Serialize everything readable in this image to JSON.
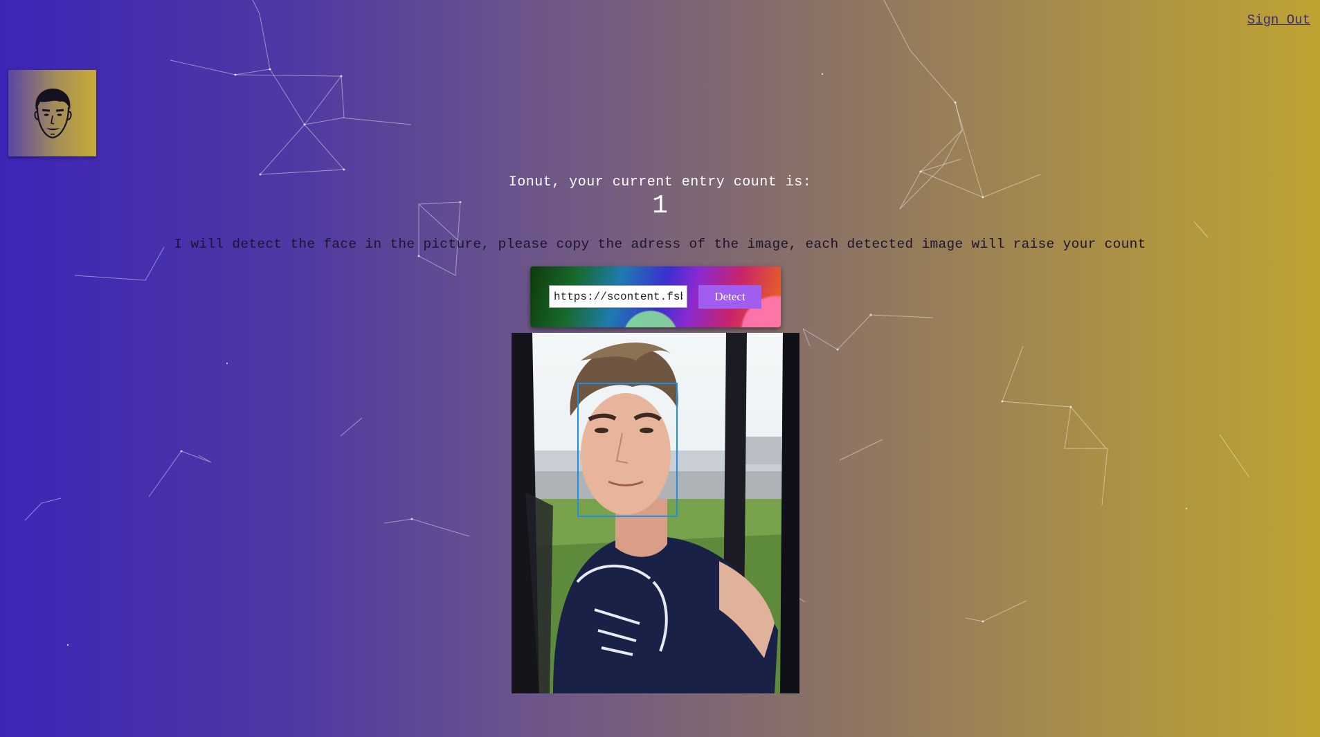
{
  "header": {
    "signout_label": "Sign Out"
  },
  "logo": {
    "icon": "face-avatar-icon"
  },
  "main": {
    "greeting": "Ionut, your current entry count is:",
    "entry_count": "1",
    "instructions": "I will detect the face in the picture, please copy the adress of the image, each detected image will raise your count"
  },
  "form": {
    "url_value": "https://scontent.fsb",
    "detect_label": "Detect"
  },
  "colors": {
    "accent_button": "#a15cf0",
    "face_box": "#1f8fe6",
    "gradient_start": "#3d25b7",
    "gradient_end": "#bea332"
  }
}
